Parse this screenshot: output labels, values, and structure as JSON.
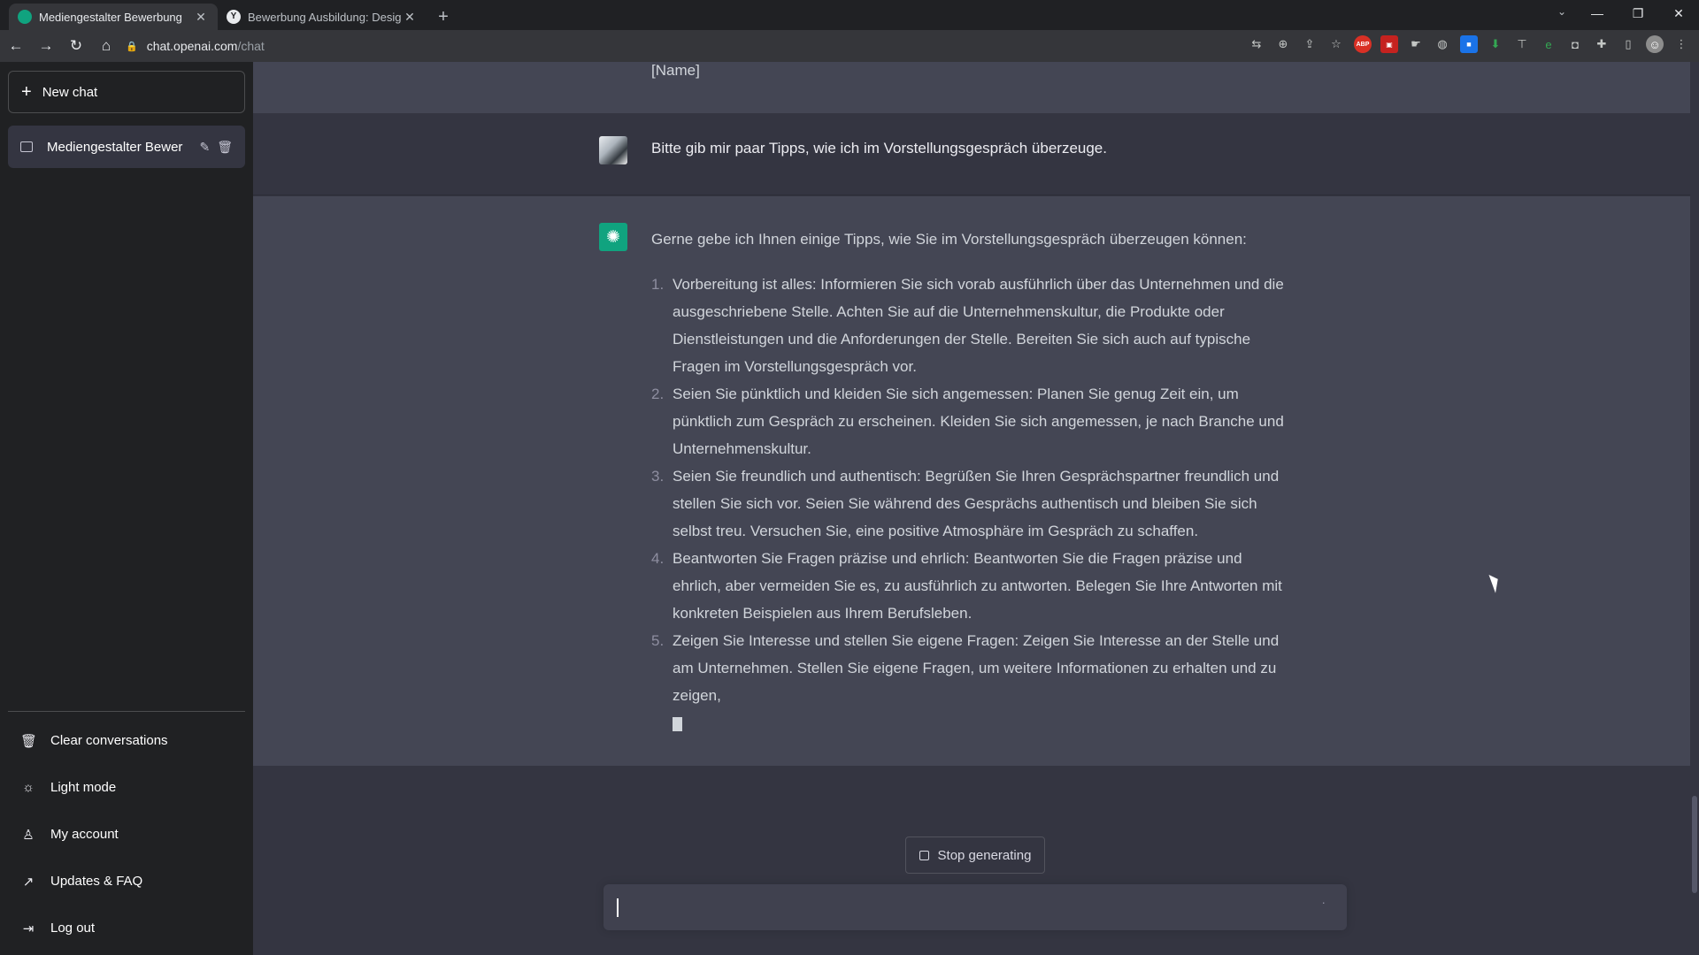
{
  "browser": {
    "tabs": [
      {
        "title": "Mediengestalter Bewerbung",
        "active": true
      },
      {
        "title": "Bewerbung Ausbildung: Design-",
        "active": false
      }
    ],
    "address": {
      "host": "chat.openai.com",
      "path": "/chat"
    },
    "extensions": [
      "translate-icon",
      "zoom-icon",
      "share-icon",
      "star-icon",
      "abp-icon",
      "red-ext-icon",
      "hand-ext-icon",
      "globe-ext-icon",
      "blue-ext-icon",
      "download-ext-icon",
      "pin-ext-icon",
      "e-ext-icon",
      "camera-ext-icon",
      "puzzle-icon",
      "sidepanel-icon",
      "profile-avatar-icon",
      "menu-icon"
    ]
  },
  "sidebar": {
    "new_chat": "New chat",
    "conversation": "Mediengestalter Bewer",
    "bottom_items": [
      {
        "label": "Clear conversations",
        "icon": "trash-icon"
      },
      {
        "label": "Light mode",
        "icon": "sun-icon"
      },
      {
        "label": "My account",
        "icon": "user-icon"
      },
      {
        "label": "Updates & FAQ",
        "icon": "external-link-icon"
      },
      {
        "label": "Log out",
        "icon": "logout-icon"
      }
    ]
  },
  "thread": {
    "previous_tail": "[Name]",
    "user_message": "Bitte gib mir paar Tipps, wie ich im Vorstellungsgespräch überzeuge.",
    "assistant": {
      "intro": "Gerne gebe ich Ihnen einige Tipps, wie Sie im Vorstellungsgespräch überzeugen können:",
      "items": [
        {
          "n": "1.",
          "text": "Vorbereitung ist alles: Informieren Sie sich vorab ausführlich über das Unternehmen und die ausgeschriebene Stelle. Achten Sie auf die Unternehmenskultur, die Produkte oder Dienstleistungen und die Anforderungen der Stelle. Bereiten Sie sich auch auf typische Fragen im Vorstellungsgespräch vor."
        },
        {
          "n": "2.",
          "text": "Seien Sie pünktlich und kleiden Sie sich angemessen: Planen Sie genug Zeit ein, um pünktlich zum Gespräch zu erscheinen. Kleiden Sie sich angemessen, je nach Branche und Unternehmenskultur."
        },
        {
          "n": "3.",
          "text": "Seien Sie freundlich und authentisch: Begrüßen Sie Ihren Gesprächspartner freundlich und stellen Sie sich vor. Seien Sie während des Gesprächs authentisch und bleiben Sie sich selbst treu. Versuchen Sie, eine positive Atmosphäre im Gespräch zu schaffen."
        },
        {
          "n": "4.",
          "text": "Beantworten Sie Fragen präzise und ehrlich: Beantworten Sie die Fragen präzise und ehrlich, aber vermeiden Sie es, zu ausführlich zu antworten. Belegen Sie Ihre Antworten mit konkreten Beispielen aus Ihrem Berufsleben."
        },
        {
          "n": "5.",
          "text": "Zeigen Sie Interesse und stellen Sie eigene Fragen: Zeigen Sie Interesse an der Stelle und am Unternehmen. Stellen Sie eigene Fragen, um weitere Informationen zu erhalten und zu zeigen,"
        }
      ]
    }
  },
  "composer": {
    "stop_label": "Stop generating",
    "input_value": "",
    "status_dots": "·"
  }
}
